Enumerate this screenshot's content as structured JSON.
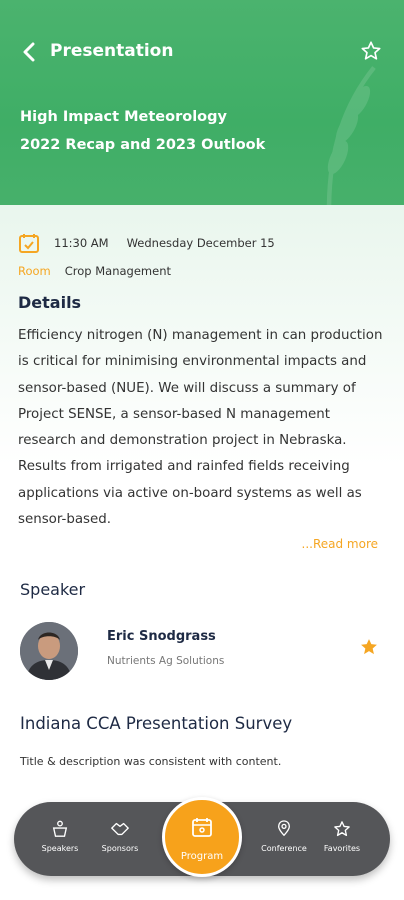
{
  "header": {
    "title": "Presentation",
    "talk_title_line1": "High Impact Meteorology",
    "talk_title_line2": "2022 Recap and 2023 Outlook"
  },
  "meta": {
    "time": "11:30 AM",
    "date": "Wednesday  December 15",
    "room_label": "Room",
    "room_value": "Crop Management"
  },
  "details": {
    "heading": "Details",
    "body": "Efficiency nitrogen (N) management in can production is critical for minimising environmental impacts and sensor-based (NUE). We will discuss a summary of Project SENSE, a sensor-based N management research and demonstration project in Nebraska. Results from irrigated and rainfed fields receiving applications via active on-board systems as well as sensor-based.",
    "read_more": "...Read more"
  },
  "speaker": {
    "heading": "Speaker",
    "name": "Eric Snodgrass",
    "org": "Nutrients Ag Solutions"
  },
  "survey": {
    "heading": "Indiana CCA Presentation Survey",
    "question": "Title & description was consistent with content."
  },
  "nav": {
    "speakers": "Speakers",
    "sponsors": "Sponsors",
    "program": "Program",
    "conference": "Conference",
    "favorites": "Favorites"
  },
  "colors": {
    "header_green": "#3fae66",
    "accent_orange": "#f5a623",
    "nav_bg": "#555659"
  }
}
